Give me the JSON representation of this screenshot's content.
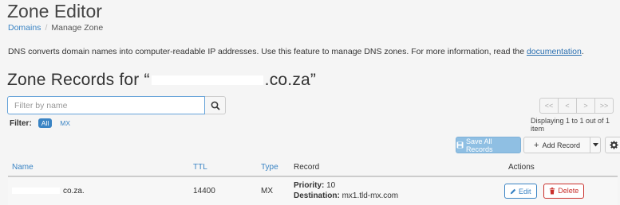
{
  "header": {
    "title": "Zone Editor",
    "breadcrumb": {
      "link": "Domains",
      "current": "Manage Zone"
    }
  },
  "description": {
    "text": "DNS converts domain names into computer-readable IP addresses. Use this feature to manage DNS zones. For more information, read the ",
    "link": "documentation",
    "suffix": "."
  },
  "zone": {
    "prefix": "Zone Records for “",
    "domain_suffix": ".co.za”"
  },
  "search": {
    "placeholder": "Filter by name",
    "icon": "search-icon"
  },
  "filter": {
    "label": "Filter:",
    "options": [
      "All",
      "MX"
    ],
    "active": "All"
  },
  "pagination": {
    "buttons": [
      "<<",
      "<",
      ">",
      ">>"
    ],
    "summary": "Displaying 1 to 1 out of 1 item"
  },
  "toolbar": {
    "save_all": "Save All Records",
    "add_record": "Add Record",
    "save_icon": "floppy-icon",
    "add_icon": "plus-icon",
    "gear_icon": "gear-icon"
  },
  "table": {
    "headers": [
      "Name",
      "TTL",
      "Type",
      "Record",
      "Actions"
    ],
    "rows": [
      {
        "name_suffix": "co.za.",
        "ttl": "14400",
        "type": "MX",
        "priority_label": "Priority:",
        "priority": "10",
        "destination_label": "Destination:",
        "destination": "mx1.tld-mx.com",
        "edit": "Edit",
        "delete": "Delete"
      }
    ]
  },
  "colors": {
    "accent": "#3a84c4",
    "danger": "#c9302c",
    "primary_button": "#8fbfe3"
  }
}
